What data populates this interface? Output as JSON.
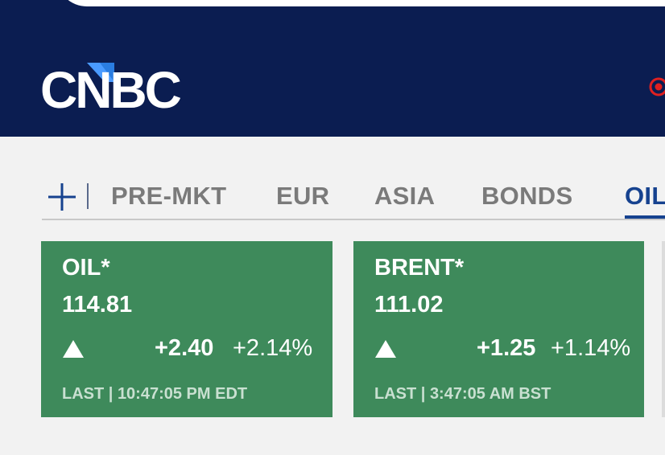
{
  "header": {
    "logo_text": "CNBC"
  },
  "tabs": {
    "add_icon": "plus-icon",
    "items": [
      {
        "label": "PRE-MKT"
      },
      {
        "label": "EUR"
      },
      {
        "label": "ASIA"
      },
      {
        "label": "BONDS"
      },
      {
        "label": "OIL"
      }
    ],
    "active_index": 4
  },
  "quotes": [
    {
      "symbol": "OIL*",
      "price": "114.81",
      "direction": "up",
      "change": "+2.40",
      "change_pct": "+2.14%",
      "last_label": "LAST",
      "last_time": "10:47:05 PM EDT"
    },
    {
      "symbol": "BRENT*",
      "price": "111.02",
      "direction": "up",
      "change": "+1.25",
      "change_pct": "+1.14%",
      "last_label": "LAST",
      "last_time": "3:47:05 AM BST"
    }
  ],
  "colors": {
    "header_bg": "#0b1d51",
    "card_up": "#3e8a5b",
    "accent": "#16428f",
    "live_red": "#e02020"
  }
}
